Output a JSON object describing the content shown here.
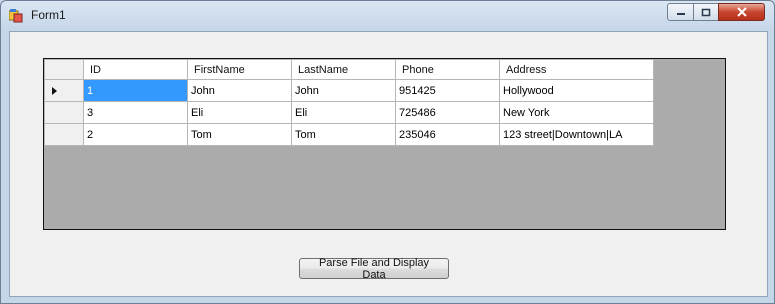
{
  "window": {
    "title": "Form1"
  },
  "grid": {
    "columns": [
      "ID",
      "FirstName",
      "LastName",
      "Phone",
      "Address"
    ],
    "rows": [
      [
        "1",
        "John",
        "John",
        "951425",
        "Hollywood"
      ],
      [
        "3",
        "Eli",
        "Eli",
        "725486",
        "New York"
      ],
      [
        "2",
        "Tom",
        "Tom",
        "235046",
        "123 street|Downtown|LA"
      ]
    ],
    "current_row_icon": "triangle-right-icon"
  },
  "button": {
    "label": "Parse File and Display Data"
  },
  "colors": {
    "selection": "#3399ff",
    "grid_background": "#ababab",
    "close_button": "#c7462f"
  }
}
